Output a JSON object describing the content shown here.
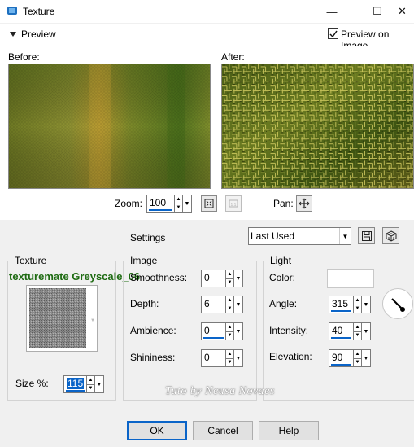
{
  "window": {
    "title": "Texture",
    "minimize_glyph": "—",
    "maximize_glyph": "☐",
    "close_glyph": "✕"
  },
  "preview": {
    "toggle_label": "Preview",
    "preview_on_image_label": "Preview on Image",
    "preview_on_image_checked": true,
    "before_label": "Before:",
    "after_label": "After:",
    "zoom_label": "Zoom:",
    "zoom_value": "100",
    "pan_label": "Pan:"
  },
  "settings": {
    "label": "Settings",
    "preset_value": "Last Used"
  },
  "texture": {
    "group_label": "Texture",
    "name": "texturemate Greyscale_06",
    "size_label": "Size %:",
    "size_value": "115"
  },
  "image": {
    "group_label": "Image",
    "smoothness_label": "Smoothness:",
    "smoothness_value": "0",
    "depth_label": "Depth:",
    "depth_value": "6",
    "ambience_label": "Ambience:",
    "ambience_value": "0",
    "shininess_label": "Shininess:",
    "shininess_value": "0"
  },
  "light": {
    "group_label": "Light",
    "color_label": "Color:",
    "color_value": "#ffffff",
    "angle_label": "Angle:",
    "angle_value": "315",
    "intensity_label": "Intensity:",
    "intensity_value": "40",
    "elevation_label": "Elevation:",
    "elevation_value": "90"
  },
  "watermark": "Tuto by Neusa Novaes",
  "buttons": {
    "ok": "OK",
    "cancel": "Cancel",
    "help": "Help"
  },
  "colors": {
    "accent": "#0a64c8",
    "texture_name": "#1e6b12"
  }
}
